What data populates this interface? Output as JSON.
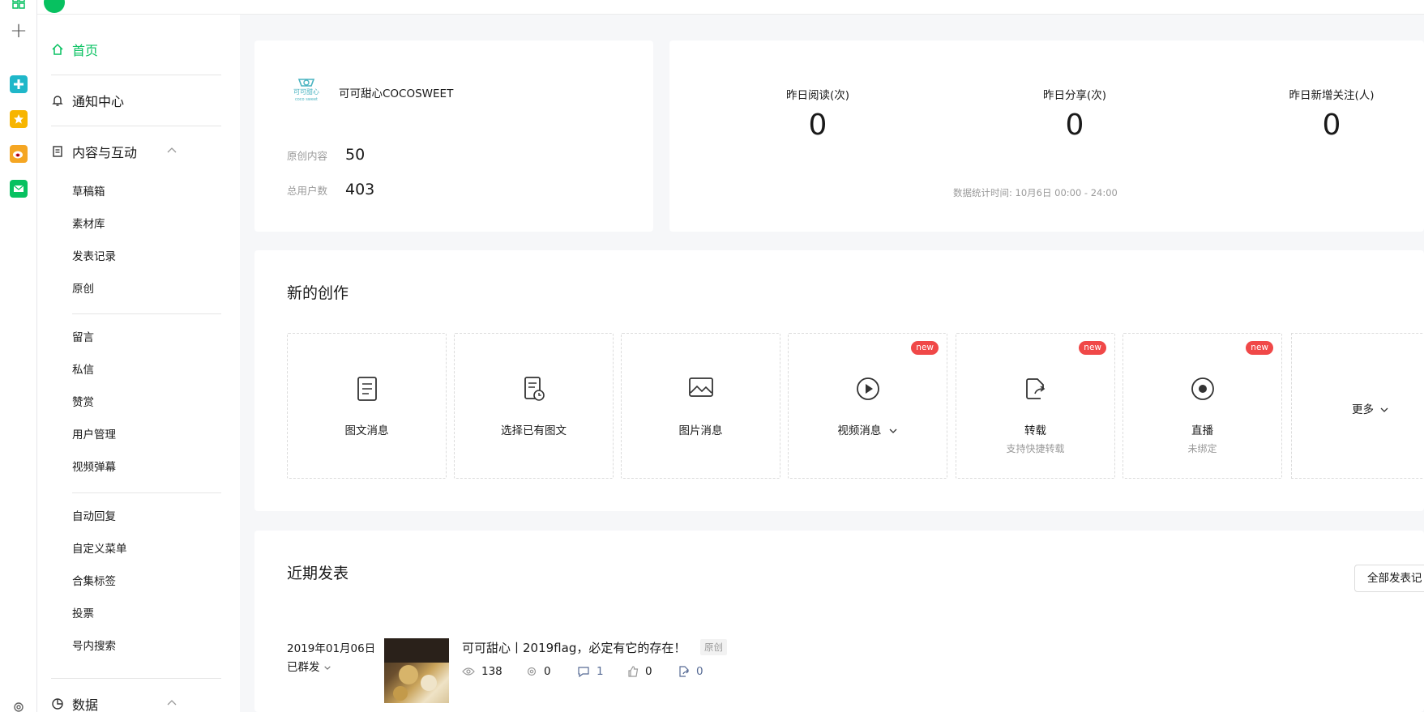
{
  "sidebar": {
    "home": "首页",
    "notice": "通知中心",
    "content": "内容与互动",
    "group1": [
      "草稿箱",
      "素材库",
      "发表记录",
      "原创"
    ],
    "group2": [
      "留言",
      "私信",
      "赞赏",
      "用户管理",
      "视频弹幕"
    ],
    "group3": [
      "自动回复",
      "自定义菜单",
      "合集标签",
      "投票",
      "号内搜索"
    ],
    "data": "数据"
  },
  "account": {
    "name": "可可甜心COCOSWEET",
    "logo_text_top": "可可甜心",
    "logo_text_bottom": "coco sweet",
    "original_label": "原创内容",
    "original_value": "50",
    "users_label": "总用户数",
    "users_value": "403"
  },
  "stats": {
    "items": [
      {
        "label": "昨日阅读(次)",
        "value": "0"
      },
      {
        "label": "昨日分享(次)",
        "value": "0"
      },
      {
        "label": "昨日新增关注(人)",
        "value": "0"
      }
    ],
    "time": "数据统计时间: 10月6日 00:00 - 24:00"
  },
  "create": {
    "title": "新的创作",
    "tiles": [
      {
        "label": "图文消息",
        "sub": "",
        "badge": ""
      },
      {
        "label": "选择已有图文",
        "sub": "",
        "badge": ""
      },
      {
        "label": "图片消息",
        "sub": "",
        "badge": ""
      },
      {
        "label": "视频消息",
        "sub": "",
        "badge": "new"
      },
      {
        "label": "转载",
        "sub": "支持快捷转载",
        "badge": "new"
      },
      {
        "label": "直播",
        "sub": "未绑定",
        "badge": "new"
      }
    ],
    "more": "更多"
  },
  "recent": {
    "title": "近期发表",
    "all_button": "全部发表记",
    "post": {
      "date": "2019年01月06日",
      "status": "已群发",
      "title": "可可甜心丨2019flag，必定有它的存在！",
      "tag": "原创",
      "reads": "138",
      "shares": "0",
      "comments": "1",
      "likes": "0",
      "forwards": "0"
    }
  },
  "colors": {
    "accent": "#07c160",
    "badge": "#f04848",
    "muted": "#9a9a9a"
  }
}
